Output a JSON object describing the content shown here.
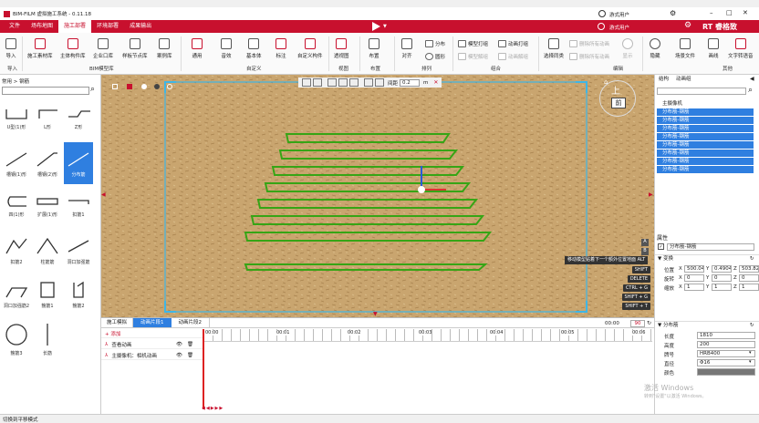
{
  "window": {
    "title": "BIM-FILM 虚拟施工系统 - 0.11.18",
    "user_label": "游式用户",
    "controls": [
      "–",
      "□",
      "✕"
    ]
  },
  "menu": {
    "tabs": [
      "文件",
      "场布地图",
      "施工部署",
      "环境部署",
      "成果输出"
    ],
    "active_index": 2
  },
  "ribbon": {
    "import": {
      "label": "导入",
      "group": "导入"
    },
    "bim_buttons": [
      "施工素材库",
      "主体构件库",
      "企业口库",
      "样板节点库",
      "案例库"
    ],
    "bim_group": "BIM模型库",
    "custom_buttons": [
      "通用",
      "音效",
      "基本体",
      "标注",
      "自定义构件"
    ],
    "custom_group": "自定义",
    "view_buttons": [
      "透视图"
    ],
    "view_group": "视图",
    "layout_buttons": [
      "布置"
    ],
    "layout_group": "布置",
    "arrange_buttons": [
      "对齐",
      "分布",
      "圆形"
    ],
    "arrange_group": "排列",
    "combine_buttons": [
      "模型打组",
      "动画打组",
      "模型解组",
      "动画解组"
    ],
    "combine_group": "组合",
    "edit_buttons": [
      "选择同类",
      "删除所有动画",
      "删除所有动画",
      "显示"
    ],
    "edit_group": "编辑",
    "other_buttons": [
      "隐藏",
      "场景文件",
      "画线",
      "文字转语音"
    ],
    "other_group": "其他",
    "brand": "RT 睿格致"
  },
  "left_panel": {
    "breadcrumb": "常用 > 钢筋",
    "search_placeholder": "",
    "shapes": [
      "U型(1)形",
      "L形",
      "Z形",
      "槽钢(1)形",
      "槽钢(2)形",
      "分布筋",
      "四(1)形",
      "扩展(1)形",
      "扣筋1",
      "扣筋2",
      "柱筋筋",
      "洞口加强筋",
      "洞口加强筋2",
      "箍筋1",
      "箍筋2",
      "箍筋3",
      "长筋"
    ],
    "selected_index": 5
  },
  "viewport": {
    "toolbar_label": "间距",
    "spacing_value": "0.2",
    "spacing_unit": "m",
    "cube_top": "上",
    "cube_front": "前",
    "hint": "移动模型贴着下一个额外位置地面 ALT",
    "hotkeys": [
      "SHIFT",
      "DELETE",
      "CTRL + G",
      "SHIFT + G",
      "SHIFT + T"
    ],
    "side_icons": [
      "A",
      "B"
    ],
    "colors": {
      "ground": "#c9a56f",
      "rebar": "#36a515",
      "frame": "#3fb6e6"
    }
  },
  "timeline": {
    "tabs": [
      "施工模拟",
      "动画片段1",
      "动画片段2"
    ],
    "active_tab": 1,
    "current_time": "00:00",
    "total_frames": "90",
    "add_label": "+ 添加",
    "tracks": [
      "查看动画",
      "主摄像机：相机动画"
    ],
    "marks": [
      "00:00",
      "00:01",
      "00:02",
      "00:03",
      "00:04",
      "00:05",
      "00:06"
    ]
  },
  "right_panel": {
    "tabs": [
      "结构",
      "动画组"
    ],
    "tree_root": "主摄像机",
    "tree_items": [
      "分布筋-钢筋",
      "分布筋-钢筋",
      "分布筋-钢筋",
      "分布筋-钢筋",
      "分布筋-钢筋",
      "分布筋-钢筋",
      "分布筋-钢筋",
      "分布筋-钢筋"
    ],
    "props_title": "属性",
    "selected_name": "分布筋-钢筋",
    "transform_title": "变换",
    "position_label": "位置",
    "position": {
      "x": "500.04",
      "y": "0.4904",
      "z": "503.82"
    },
    "rotation_label": "旋转",
    "rotation": {
      "x": "0",
      "y": "0",
      "z": "0"
    },
    "scale_label": "缩放",
    "scale": {
      "x": "1",
      "y": "1",
      "z": "1"
    },
    "rebar_title": "分布筋",
    "length_label": "长度",
    "length": "1810",
    "height_label": "高度",
    "height": "200",
    "grade_label": "牌号",
    "grade": "HRB400",
    "diameter_label": "直径",
    "diameter": "Φ16",
    "color_label": "颜色",
    "watermark_line1": "激活 Windows",
    "watermark_line2": "转到\"设置\"以激活 Windows。"
  },
  "status": {
    "text": "切换到平移模式"
  }
}
